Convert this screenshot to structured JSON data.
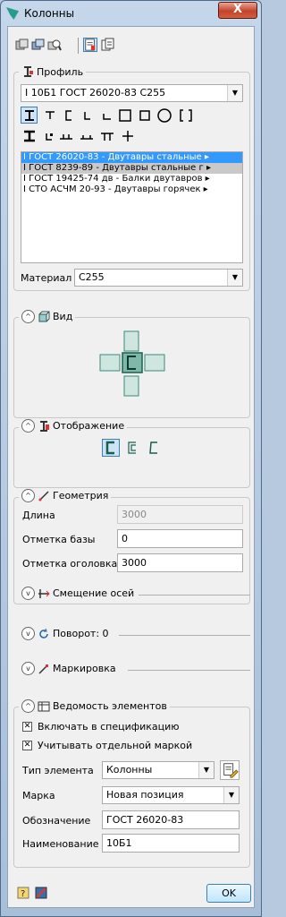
{
  "window": {
    "title": "Колонны",
    "close_label": "X"
  },
  "toolbar": {
    "icons": [
      "layer-icon",
      "layer-copy-icon",
      "search-layer-icon",
      "properties-icon",
      "copy-properties-icon"
    ]
  },
  "profile": {
    "legend": "Профиль",
    "selected": "I 10Б1 ГОСТ 26020-83 С255",
    "shapes": [
      "i-beam",
      "t-section",
      "channel",
      "angle",
      "unequal-angle",
      "rect-tube",
      "square-tube",
      "round-tube",
      "c-bracket",
      "h-section",
      "plate",
      "double-angle",
      "double-angle-2",
      "double-t",
      "cross"
    ],
    "list": [
      {
        "text": "I ГОСТ 26020-83 - Двутавры стальные ▸",
        "state": "selected"
      },
      {
        "text": "I ГОСТ 8239-89 - Двутавры стальные г ▸",
        "state": "hover"
      },
      {
        "text": "I ГОСТ 19425-74 дв - Балки двутавров ▸",
        "state": "normal"
      },
      {
        "text": "I СТО АСЧМ 20-93 - Двутавры горячек ▸",
        "state": "normal"
      }
    ],
    "material_label": "Материал",
    "material_value": "С255"
  },
  "view": {
    "legend": "Вид",
    "collapse": "^"
  },
  "display": {
    "legend": "Отображение",
    "collapse": "^"
  },
  "geometry": {
    "legend": "Геометрия",
    "collapse": "^",
    "length_label": "Длина",
    "length_value": "3000",
    "base_label": "Отметка базы",
    "base_value": "0",
    "head_label": "Отметка оголовка",
    "head_value": "3000"
  },
  "offset": {
    "legend": "Смещение осей",
    "collapse": "v"
  },
  "rotation": {
    "legend": "Поворот: 0",
    "collapse": "v"
  },
  "marking": {
    "legend": "Маркировка",
    "collapse": "v"
  },
  "spec": {
    "legend": "Ведомость элементов",
    "collapse": "^",
    "include_label": "Включать в спецификацию",
    "include_checked": "✕",
    "separate_label": "Учитывать отдельной маркой",
    "separate_checked": "✕",
    "type_label": "Тип элемента",
    "type_value": "Колонны",
    "mark_label": "Марка",
    "mark_value": "Новая позиция",
    "designation_label": "Обозначение",
    "designation_value": "ГОСТ 26020-83",
    "name_label": "Наименование",
    "name_value": "10Б1"
  },
  "footer": {
    "ok_label": "OK"
  },
  "colors": {
    "accent": "#3c7fb1",
    "selection": "#3399ff",
    "icon_teal": "#2a9a8f"
  }
}
